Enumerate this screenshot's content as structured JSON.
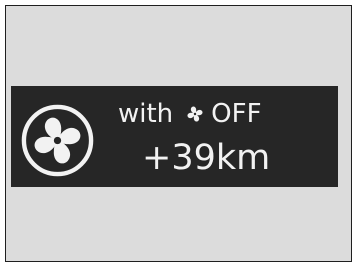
{
  "message": {
    "prefix": "with",
    "state": "OFF",
    "range_gain": "+39km"
  },
  "icons": {
    "large": "fan-icon",
    "inline": "fan-icon"
  },
  "colors": {
    "panel": "#dcdcdc",
    "banner": "#262626",
    "text": "#f2f2f2"
  }
}
